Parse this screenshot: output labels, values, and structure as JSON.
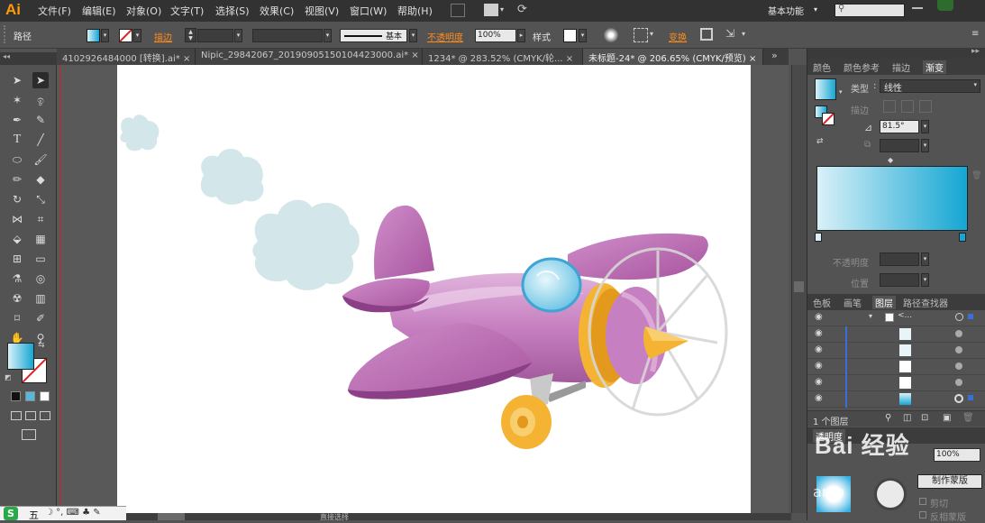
{
  "app": {
    "logo": "Ai",
    "menus": [
      "文件(F)",
      "编辑(E)",
      "对象(O)",
      "文字(T)",
      "选择(S)",
      "效果(C)",
      "视图(V)",
      "窗口(W)",
      "帮助(H)"
    ],
    "workspace": "基本功能",
    "workspace_arrow": "▾",
    "search_placeholder": ""
  },
  "control_bar": {
    "object_type": "路径",
    "stroke_label": "描边",
    "stroke_value": "",
    "stroke_style": "基本",
    "opacity_label": "不透明度",
    "opacity_value": "100%",
    "style_label": "样式",
    "transform_label": "变换",
    "fill_color": "#56b9d9",
    "accent": "#ff8c1a"
  },
  "tabs": [
    {
      "label": "4102926484000 [转换].ai*",
      "close": "×",
      "active": false
    },
    {
      "label": "Nipic_29842067_20190905150104423000.ai*",
      "close": "×",
      "active": false
    },
    {
      "label": "1234* @ 283.52% (CMYK/轮...",
      "close": "×",
      "active": false
    },
    {
      "label": "未标题-24* @ 206.65% (CMYK/预览)",
      "close": "×",
      "active": true
    }
  ],
  "tab_overflow": "»",
  "toolbox": {
    "collapse": "◂◂",
    "tools": [
      "selection-tool-icon",
      "direct-selection-tool-icon",
      "magic-wand-tool-icon",
      "lasso-tool-icon",
      "pen-tool-icon",
      "curvature-tool-icon",
      "type-tool-icon",
      "line-tool-icon",
      "ellipse-tool-icon",
      "paintbrush-tool-icon",
      "pencil-tool-icon",
      "eraser-tool-icon",
      "rotate-tool-icon",
      "scale-tool-icon",
      "width-tool-icon",
      "free-transform-tool-icon",
      "shape-builder-tool-icon",
      "perspective-tool-icon",
      "mesh-tool-icon",
      "gradient-tool-icon",
      "eyedropper-tool-icon",
      "blend-tool-icon",
      "symbol-sprayer-tool-icon",
      "graph-tool-icon",
      "artboard-tool-icon",
      "slice-tool-icon",
      "hand-tool-icon",
      "zoom-tool-icon"
    ],
    "fill_color": "#56b9d9"
  },
  "gradient_panel": {
    "tabs": [
      "颜色",
      "颜色参考",
      "描边",
      "渐变"
    ],
    "type_label": "类型",
    "type_value": "线性",
    "stroke_label": "描边",
    "angle_value": "81.5°",
    "opacity_label": "不透明度",
    "position_label": "位置",
    "stop_left": "#d9f1f8",
    "stop_right": "#15a6d3"
  },
  "layers_panel": {
    "tabs": [
      "色板",
      "画笔",
      "图层",
      "路径查找器"
    ],
    "top_label": "<...",
    "row_count": 6,
    "footer_count": "1 个图层",
    "watermark": "Bai 经验",
    "transparency_tab": "透明度",
    "transparency_value": "100%",
    "make_mask": "制作蒙版",
    "clip_label": "剪切",
    "invert_mask": "反相蒙版",
    "url_fragment": "an.b"
  },
  "status": {
    "zoom_left": "",
    "center_label": "直接选择"
  },
  "taskbar": {
    "ime": "五",
    "glyphs": "☽ °, ⌨ ♣ ✎"
  },
  "artwork": {
    "body_color": "#c67fc0",
    "body_dark": "#9a4e95",
    "ring_color": "#f5b334",
    "cockpit_color": "#8fd3ef",
    "smoke_color": "#d3e6ea"
  }
}
